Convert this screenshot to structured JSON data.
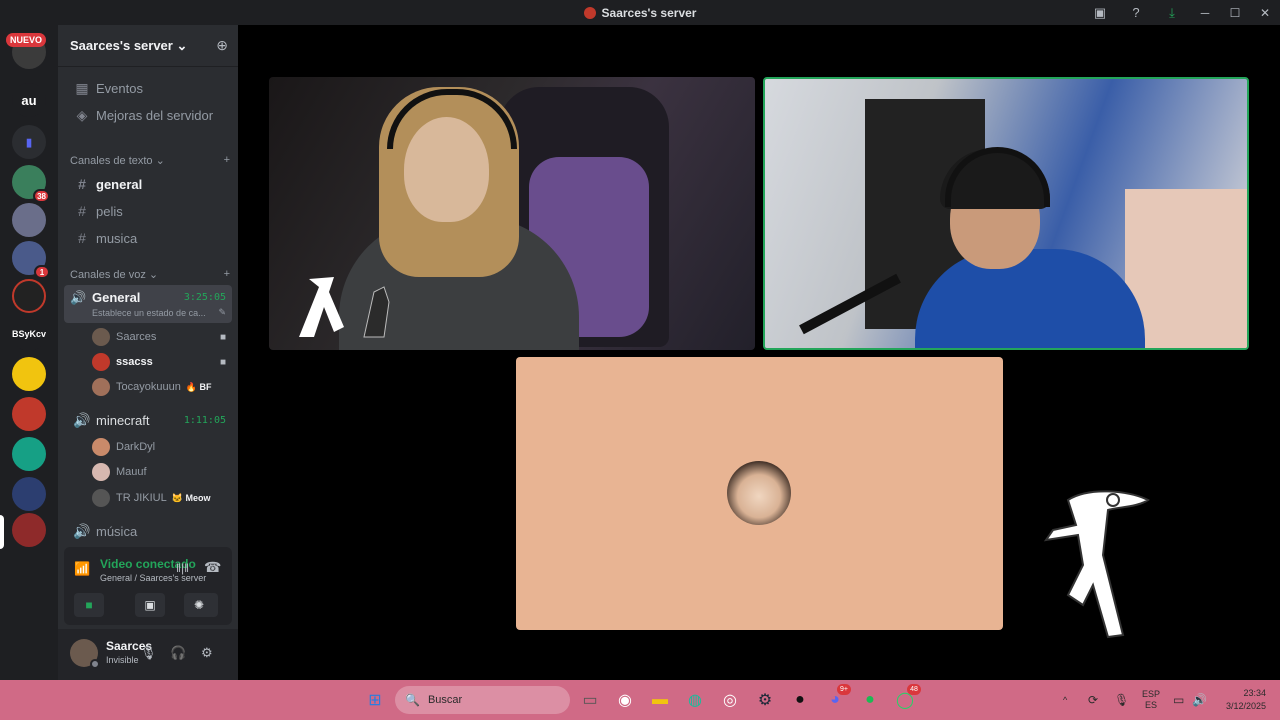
{
  "window": {
    "title": "Saarces's server",
    "icons": [
      "screen-share-icon",
      "help-icon",
      "download-icon"
    ],
    "controls": [
      "─",
      "☐",
      "✕"
    ]
  },
  "guilds": {
    "new_badge": "NUEVO",
    "items": [
      {
        "label": "",
        "badge": ""
      },
      {
        "label": "au",
        "badge": ""
      },
      {
        "label": "",
        "badge": ""
      },
      {
        "label": "",
        "badge": "38"
      },
      {
        "label": "",
        "badge": ""
      },
      {
        "label": "",
        "badge": "1"
      },
      {
        "label": "",
        "badge": ""
      },
      {
        "label": "BSyKcv",
        "badge": ""
      },
      {
        "label": "",
        "badge": ""
      },
      {
        "label": "",
        "badge": ""
      },
      {
        "label": "",
        "badge": ""
      },
      {
        "label": "",
        "badge": ""
      },
      {
        "label": "",
        "badge": ""
      }
    ]
  },
  "server": {
    "name": "Saarces's server",
    "top_links": [
      {
        "label": "Eventos",
        "icon": "calendar-icon"
      },
      {
        "label": "Mejoras del servidor",
        "icon": "boost-icon"
      }
    ],
    "text_category": "Canales de texto",
    "text_channels": [
      "general",
      "pelis",
      "musica"
    ],
    "voice_category": "Canales de voz",
    "voice_channels": [
      {
        "name": "General",
        "time": "3:25:05",
        "status": "Establece un estado de ca...",
        "users": [
          {
            "name": "Saarces",
            "tag": "",
            "cam": true
          },
          {
            "name": "ssacss",
            "tag": "",
            "cam": true
          },
          {
            "name": "Tocayokuuun",
            "tag": "BF",
            "cam": false
          }
        ]
      },
      {
        "name": "minecraft",
        "time": "1:11:05",
        "users": [
          {
            "name": "DarkDyl",
            "tag": ""
          },
          {
            "name": "Mauuf",
            "tag": ""
          },
          {
            "name": "TR JIKIUL",
            "tag": "Meow"
          }
        ]
      },
      {
        "name": "música",
        "time": ""
      }
    ]
  },
  "connection": {
    "title": "Video conectado",
    "subtitle": "General / Saarces's server"
  },
  "user": {
    "name": "Saarces",
    "status": "Invisible"
  },
  "taskbar": {
    "search_placeholder": "Buscar",
    "whatsapp_badge": "48",
    "discord_badge": "9+",
    "lang_top": "ESP",
    "lang_bottom": "ES",
    "time": "23:34",
    "date": "3/12/2025"
  }
}
